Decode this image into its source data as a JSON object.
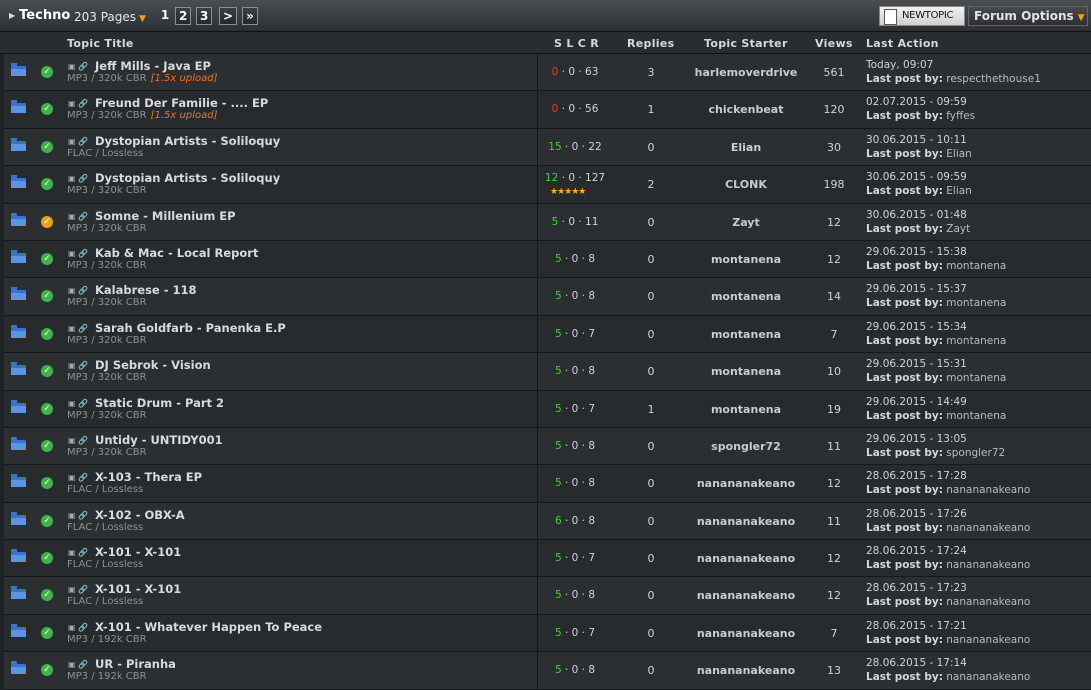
{
  "toolbar": {
    "forum_name": "Techno",
    "pages_label": "203 Pages",
    "page_links": [
      "1",
      "2",
      "3",
      ">",
      "»"
    ],
    "new_topic_label": "NEWTOPIC",
    "options_label": "Forum Options"
  },
  "columns": {
    "title": "Topic Title",
    "slcr": "S L C R",
    "replies": "Replies",
    "starter": "Topic Starter",
    "views": "Views",
    "last_action": "Last Action",
    "last_post_prefix": "Last post by:"
  },
  "colors": {
    "seeders": "#3fd13a",
    "seeders_zero": "#e33a2b",
    "upload": "#e8722c",
    "accent": "#f59e1b"
  },
  "topics": [
    {
      "title": "Jeff Mills - Java EP",
      "format": "MP3 / 320k CBR",
      "upload": "[1.5x upload]",
      "s": "0",
      "lcr": "· 0 · 63",
      "rating": "",
      "replies": "3",
      "starter": "harlemoverdrive",
      "views": "561",
      "date": "Today, 09:07",
      "last_by": "respecthethouse1",
      "status": "ok"
    },
    {
      "title": "Freund Der Familie - .... EP",
      "format": "MP3 / 320k CBR",
      "upload": "[1.5x upload]",
      "s": "0",
      "lcr": "· 0 · 56",
      "rating": "",
      "replies": "1",
      "starter": "chickenbeat",
      "views": "120",
      "date": "02.07.2015 - 09:59",
      "last_by": "fyffes",
      "status": "ok"
    },
    {
      "title": "Dystopian Artists - Soliloquy",
      "format": "FLAC / Lossless",
      "upload": "",
      "s": "15",
      "lcr": "· 0 · 22",
      "rating": "",
      "replies": "0",
      "starter": "Elian",
      "views": "30",
      "date": "30.06.2015 - 10:11",
      "last_by": "Elian",
      "status": "ok"
    },
    {
      "title": "Dystopian Artists - Soliloquy",
      "format": "MP3 / 320k CBR",
      "upload": "",
      "s": "12",
      "lcr": "· 0 · 127",
      "rating": "★★★★★",
      "replies": "2",
      "starter": "CLONK",
      "views": "198",
      "date": "30.06.2015 - 09:59",
      "last_by": "Elian",
      "status": "ok"
    },
    {
      "title": "Somne - Millenium EP",
      "format": "MP3 / 320k CBR",
      "upload": "",
      "s": "5",
      "lcr": "· 0 · 11",
      "rating": "",
      "replies": "0",
      "starter": "Zayt",
      "views": "12",
      "date": "30.06.2015 - 01:48",
      "last_by": "Zayt",
      "status": "hot"
    },
    {
      "title": "Kab & Mac - Local Report",
      "format": "MP3 / 320k CBR",
      "upload": "",
      "s": "5",
      "lcr": "· 0 · 8",
      "rating": "",
      "replies": "0",
      "starter": "montanena",
      "views": "12",
      "date": "29.06.2015 - 15:38",
      "last_by": "montanena",
      "status": "ok"
    },
    {
      "title": "Kalabrese - 118",
      "format": "MP3 / 320k CBR",
      "upload": "",
      "s": "5",
      "lcr": "· 0 · 8",
      "rating": "",
      "replies": "0",
      "starter": "montanena",
      "views": "14",
      "date": "29.06.2015 - 15:37",
      "last_by": "montanena",
      "status": "ok"
    },
    {
      "title": "Sarah Goldfarb - Panenka E.P",
      "format": "MP3 / 320k CBR",
      "upload": "",
      "s": "5",
      "lcr": "· 0 · 7",
      "rating": "",
      "replies": "0",
      "starter": "montanena",
      "views": "7",
      "date": "29.06.2015 - 15:34",
      "last_by": "montanena",
      "status": "ok"
    },
    {
      "title": "DJ Sebrok - Vision",
      "format": "MP3 / 320k CBR",
      "upload": "",
      "s": "5",
      "lcr": "· 0 · 8",
      "rating": "",
      "replies": "0",
      "starter": "montanena",
      "views": "10",
      "date": "29.06.2015 - 15:31",
      "last_by": "montanena",
      "status": "ok"
    },
    {
      "title": "Static Drum - Part 2",
      "format": "MP3 / 320k CBR",
      "upload": "",
      "s": "5",
      "lcr": "· 0 · 7",
      "rating": "",
      "replies": "1",
      "starter": "montanena",
      "views": "19",
      "date": "29.06.2015 - 14:49",
      "last_by": "montanena",
      "status": "ok"
    },
    {
      "title": "Untidy - UNTIDY001",
      "format": "MP3 / 320k CBR",
      "upload": "",
      "s": "5",
      "lcr": "· 0 · 8",
      "rating": "",
      "replies": "0",
      "starter": "spongler72",
      "views": "11",
      "date": "29.06.2015 - 13:05",
      "last_by": "spongler72",
      "status": "ok"
    },
    {
      "title": "X-103 - Thera EP",
      "format": "FLAC / Lossless",
      "upload": "",
      "s": "5",
      "lcr": "· 0 · 8",
      "rating": "",
      "replies": "0",
      "starter": "nanananakeano",
      "views": "12",
      "date": "28.06.2015 - 17:28",
      "last_by": "nanananakeano",
      "status": "ok"
    },
    {
      "title": "X-102 - OBX-A",
      "format": "FLAC / Lossless",
      "upload": "",
      "s": "6",
      "lcr": "· 0 · 8",
      "rating": "",
      "replies": "0",
      "starter": "nanananakeano",
      "views": "11",
      "date": "28.06.2015 - 17:26",
      "last_by": "nanananakeano",
      "status": "ok"
    },
    {
      "title": "X-101 - X-101",
      "format": "FLAC / Lossless",
      "upload": "",
      "s": "5",
      "lcr": "· 0 · 7",
      "rating": "",
      "replies": "0",
      "starter": "nanananakeano",
      "views": "12",
      "date": "28.06.2015 - 17:24",
      "last_by": "nanananakeano",
      "status": "ok"
    },
    {
      "title": "X-101 - X-101",
      "format": "FLAC / Lossless",
      "upload": "",
      "s": "5",
      "lcr": "· 0 · 8",
      "rating": "",
      "replies": "0",
      "starter": "nanananakeano",
      "views": "12",
      "date": "28.06.2015 - 17:23",
      "last_by": "nanananakeano",
      "status": "ok"
    },
    {
      "title": "X-101 - Whatever Happen To Peace",
      "format": "MP3 / 192k CBR",
      "upload": "",
      "s": "5",
      "lcr": "· 0 · 7",
      "rating": "",
      "replies": "0",
      "starter": "nanananakeano",
      "views": "7",
      "date": "28.06.2015 - 17:21",
      "last_by": "nanananakeano",
      "status": "ok"
    },
    {
      "title": "UR - Piranha",
      "format": "MP3 / 192k CBR",
      "upload": "",
      "s": "5",
      "lcr": "· 0 · 8",
      "rating": "",
      "replies": "0",
      "starter": "nanananakeano",
      "views": "13",
      "date": "28.06.2015 - 17:14",
      "last_by": "nanananakeano",
      "status": "ok"
    }
  ]
}
